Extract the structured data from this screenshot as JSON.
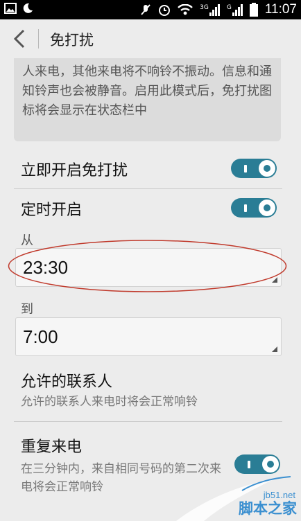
{
  "status_bar": {
    "time": "11:07",
    "net1": "3G",
    "net2": "G",
    "icons": [
      "image-icon",
      "moon-icon",
      "mute-icon",
      "alarm-icon",
      "wifi-icon",
      "signal-icon",
      "signal-icon",
      "battery-icon"
    ]
  },
  "header": {
    "title": "免打扰"
  },
  "description": {
    "text": "在免打扰模式中，只能接听经过您许可的联系人来电，其他来电将不响铃不振动。信息和通知铃声也会被静音。启用此模式后，免打扰图标将会显示在状态栏中"
  },
  "immediate": {
    "label": "立即开启免打扰",
    "enabled": true
  },
  "scheduled": {
    "label": "定时开启",
    "enabled": true,
    "from_label": "从",
    "from_value": "23:30",
    "to_label": "到",
    "to_value": "7:00"
  },
  "allowed_contacts": {
    "title": "允许的联系人",
    "subtitle": "允许的联系人来电时将会正常响铃"
  },
  "repeat_calls": {
    "title": "重复来电",
    "subtitle": "在三分钟内，来自相同号码的第二次来电将会正常响铃",
    "enabled": true
  },
  "watermark": {
    "url": "jb51.net",
    "name": "脚本之家"
  },
  "colors": {
    "toggle": "#2a7d95",
    "annotation": "#c0392b",
    "watermark": "#3a8fd0"
  }
}
